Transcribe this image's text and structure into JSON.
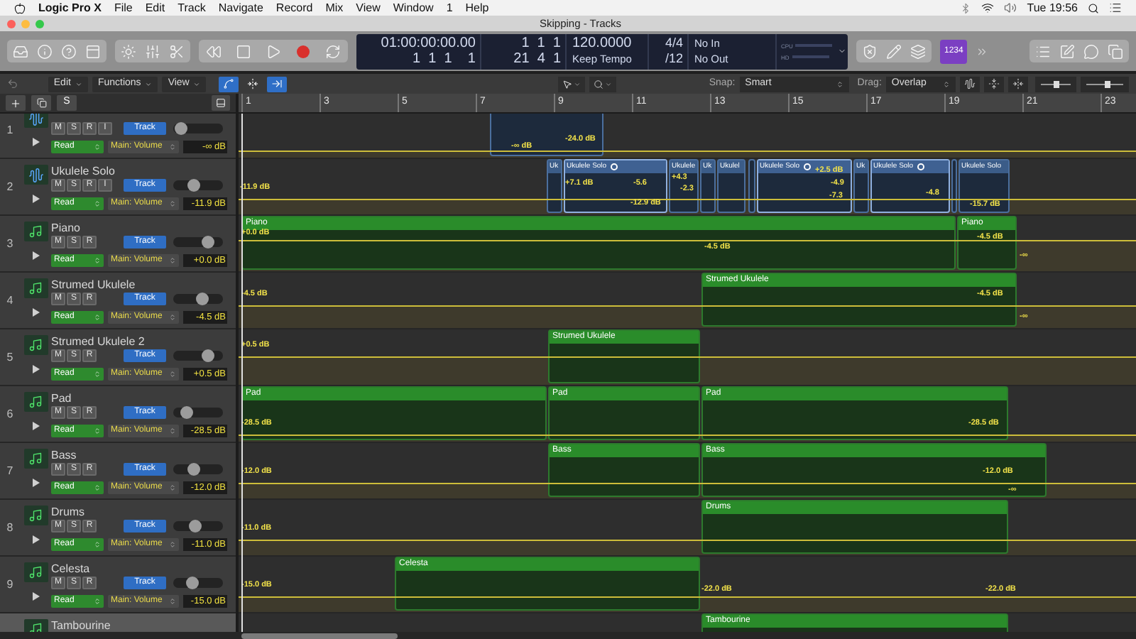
{
  "menu_bar": {
    "app": "Logic Pro X",
    "items": [
      "File",
      "Edit",
      "Track",
      "Navigate",
      "Record",
      "Mix",
      "View",
      "Window",
      "1",
      "Help"
    ],
    "clock": "Tue 19:56"
  },
  "window": {
    "title": "Skipping - Tracks"
  },
  "lcd": {
    "time": "01:00:00:00.00",
    "bars": "1  1  1    1",
    "locator_top": "1  1  1",
    "locator_bottom": "21  4  1",
    "tempo": "120.0000",
    "tempo_mode": "Keep Tempo",
    "signature": "4/4",
    "division": "/12",
    "input": "No In",
    "output": "No Out",
    "cpu_label": "CPU",
    "hd_label": "HD"
  },
  "control_bar": {
    "count_in": {
      "label": "1234",
      "on": true
    }
  },
  "toolbar": {
    "menus": [
      "Edit",
      "Functions",
      "View"
    ],
    "toggles": [
      {
        "kind": "automation",
        "on": true
      },
      {
        "kind": "flex",
        "on": false
      },
      {
        "kind": "catch",
        "on": true
      }
    ],
    "snap_label": "Snap:",
    "snap": "Smart",
    "drag_label": "Drag:",
    "drag": "Overlap",
    "vertical_zoom": {
      "level": 0.5
    },
    "horizontal_zoom": {
      "level": 0.55
    }
  },
  "header_buttons": {
    "solo": "S"
  },
  "ruler": {
    "bars": [
      "1",
      "3",
      "5",
      "7",
      "9",
      "11",
      "13",
      "15",
      "17",
      "19",
      "21",
      "23"
    ]
  },
  "tracks": [
    {
      "number": "1",
      "kind": "audio",
      "selected": false,
      "buttons": [
        "M",
        "S",
        "R",
        "I"
      ],
      "track_button": "Track",
      "level": 0.05,
      "mode": "Read",
      "parameter": "Main: Volume",
      "value": "-∞ dB",
      "regions": [
        {
          "loop": false
        }
      ],
      "automation": [
        "-∞ dB",
        "-24.0 dB"
      ]
    },
    {
      "number": "2",
      "name": "Ukulele Solo",
      "kind": "audio",
      "selected": false,
      "buttons": [
        "M",
        "S",
        "R",
        "I"
      ],
      "track_button": "Track",
      "level": 0.4,
      "mode": "Read",
      "parameter": "Main: Volume",
      "value": "-11.9 dB",
      "regions": [
        {
          "name": "Uk",
          "loop": false
        },
        {
          "name": "Ukulele Solo",
          "loop": true
        },
        {
          "name": "Ukulele",
          "loop": false
        },
        {
          "name": "Uk",
          "loop": false
        },
        {
          "name": "Ukulel",
          "loop": false
        },
        {
          "loop": false
        },
        {
          "name": "Ukulele Solo",
          "loop": true
        },
        {
          "name": "Uk",
          "loop": false
        },
        {
          "name": "Ukulele Solo",
          "loop": true
        },
        {
          "loop": false
        },
        {
          "name": "Ukulele Solo",
          "loop": false
        }
      ],
      "automation": [
        "-11.9 dB",
        "+7.1 dB",
        "-5.6",
        "+4.3",
        "-12.9 dB",
        "-2.3",
        "+2.5 dB",
        "-4.9",
        "-7.3",
        "-4.8",
        "-15.7 dB"
      ]
    },
    {
      "number": "3",
      "name": "Piano",
      "kind": "midi",
      "selected": false,
      "buttons": [
        "M",
        "S",
        "R"
      ],
      "track_button": "Track",
      "level": 0.75,
      "mode": "Read",
      "parameter": "Main: Volume",
      "value": "+0.0 dB",
      "regions": [
        {
          "name": "Piano",
          "loop": false
        },
        {
          "name": "Piano",
          "loop": false
        }
      ],
      "automation": [
        "+0.0 dB",
        "-4.5 dB",
        "-4.5 dB",
        "-∞"
      ]
    },
    {
      "number": "4",
      "name": "Strumed Ukulele",
      "kind": "midi",
      "selected": false,
      "buttons": [
        "M",
        "S",
        "R"
      ],
      "track_button": "Track",
      "level": 0.62,
      "mode": "Read",
      "parameter": "Main: Volume",
      "value": "-4.5 dB",
      "regions": [
        {
          "name": "Strumed Ukulele",
          "loop": false
        }
      ],
      "automation": [
        "-4.5 dB",
        "-4.5 dB",
        "-∞"
      ]
    },
    {
      "number": "5",
      "name": "Strumed Ukulele 2",
      "kind": "midi",
      "selected": false,
      "buttons": [
        "M",
        "S",
        "R"
      ],
      "track_button": "Track",
      "level": 0.75,
      "mode": "Read",
      "parameter": "Main: Volume",
      "value": "+0.5 dB",
      "regions": [
        {
          "name": "Strumed Ukulele",
          "loop": false
        }
      ],
      "automation": [
        "+0.5 dB"
      ]
    },
    {
      "number": "6",
      "name": "Pad",
      "kind": "midi",
      "selected": false,
      "buttons": [
        "M",
        "S",
        "R"
      ],
      "track_button": "Track",
      "level": 0.2,
      "mode": "Read",
      "parameter": "Main: Volume",
      "value": "-28.5 dB",
      "regions": [
        {
          "name": "Pad",
          "loop": false
        },
        {
          "name": "Pad",
          "loop": false
        },
        {
          "name": "Pad",
          "loop": false
        }
      ],
      "automation": [
        "-28.5 dB",
        "-28.5 dB"
      ]
    },
    {
      "number": "7",
      "name": "Bass",
      "kind": "midi",
      "selected": false,
      "buttons": [
        "M",
        "S",
        "R"
      ],
      "track_button": "Track",
      "level": 0.4,
      "mode": "Read",
      "parameter": "Main: Volume",
      "value": "-12.0 dB",
      "regions": [
        {
          "name": "Bass",
          "loop": false
        },
        {
          "name": "Bass",
          "loop": false
        }
      ],
      "automation": [
        "-12.0 dB",
        "-12.0 dB",
        "-∞"
      ]
    },
    {
      "number": "8",
      "name": "Drums",
      "kind": "midi",
      "selected": false,
      "buttons": [
        "M",
        "S",
        "R"
      ],
      "track_button": "Track",
      "level": 0.42,
      "mode": "Read",
      "parameter": "Main: Volume",
      "value": "-11.0 dB",
      "regions": [
        {
          "name": "Drums",
          "loop": false
        }
      ],
      "automation": [
        "-11.0 dB"
      ]
    },
    {
      "number": "9",
      "name": "Celesta",
      "kind": "midi",
      "selected": false,
      "buttons": [
        "M",
        "S",
        "R"
      ],
      "track_button": "Track",
      "level": 0.35,
      "mode": "Read",
      "parameter": "Main: Volume",
      "value": "-15.0 dB",
      "regions": [
        {
          "name": "Celesta",
          "loop": false
        }
      ],
      "automation": [
        "-15.0 dB",
        "-22.0 dB",
        "-22.0 dB"
      ]
    },
    {
      "name": "Tambourine",
      "kind": "midi",
      "selected": true,
      "regions": [
        {
          "name": "Tambourine",
          "loop": false
        }
      ]
    }
  ]
}
